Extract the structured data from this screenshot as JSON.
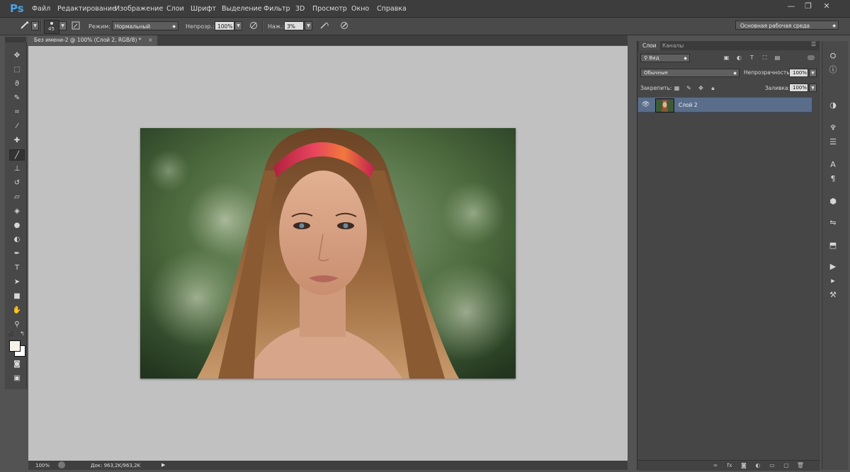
{
  "app": {
    "logo": "Ps"
  },
  "menu": [
    "Файл",
    "Редактирование",
    "Изображение",
    "Слои",
    "Шрифт",
    "Выделение",
    "Фильтр",
    "3D",
    "Просмотр",
    "Окно",
    "Справка"
  ],
  "window_controls": {
    "minimize": "—",
    "restore": "❐",
    "close": "✕"
  },
  "options": {
    "brush_size": "45",
    "mode_label": "Режим:",
    "mode_value": "Нормальный",
    "opacity_label": "Непрозр.:",
    "opacity_value": "100%",
    "pressure_label": "Наж.:",
    "pressure_value": "3%",
    "workspace": "Основная рабочая среда"
  },
  "document": {
    "tab_title": "Без имени-2 @ 100% (Слой 2, RGB/8) *",
    "tab_close": "×",
    "zoom": "100%",
    "doc_info": "Док: 963,2K/963,2K"
  },
  "layers_panel": {
    "tab_layers": "Слои",
    "tab_channels": "Каналы",
    "filter_kind": "Вид",
    "blend_mode": "Обычные",
    "opacity_label": "Непрозрачность:",
    "opacity_value": "100%",
    "lock_label": "Закрепить:",
    "fill_label": "Заливка:",
    "fill_value": "100%",
    "layers": [
      {
        "name": "Слой 2",
        "visible": true,
        "selected": true
      }
    ]
  },
  "icons": {
    "toolbar": [
      "move-icon",
      "marquee-icon",
      "lasso-icon",
      "quick-selection-icon",
      "crop-icon",
      "eyedropper-icon",
      "healing-brush-icon",
      "brush-icon",
      "clone-stamp-icon",
      "history-brush-icon",
      "eraser-icon",
      "paint-bucket-icon",
      "blur-icon",
      "dodge-icon",
      "pen-icon",
      "type-icon",
      "path-selection-icon",
      "rectangle-icon",
      "hand-icon",
      "zoom-icon",
      "quick-mask-icon",
      "screen-mode-icon"
    ],
    "right_strip": [
      "history-icon",
      "properties-icon",
      "adjustments-icon",
      "brush-preset-icon",
      "tool-preset-icon",
      "character-icon",
      "paragraph-icon",
      "3d-icon",
      "clone-source-icon",
      "layer-comps-icon",
      "actions-icon",
      "timeline-icon",
      "measurement-icon"
    ]
  },
  "colors": {
    "accent": "#4aa3e6",
    "selected_layer": "#5a6e8c",
    "canvas": "#c1c1c1"
  }
}
